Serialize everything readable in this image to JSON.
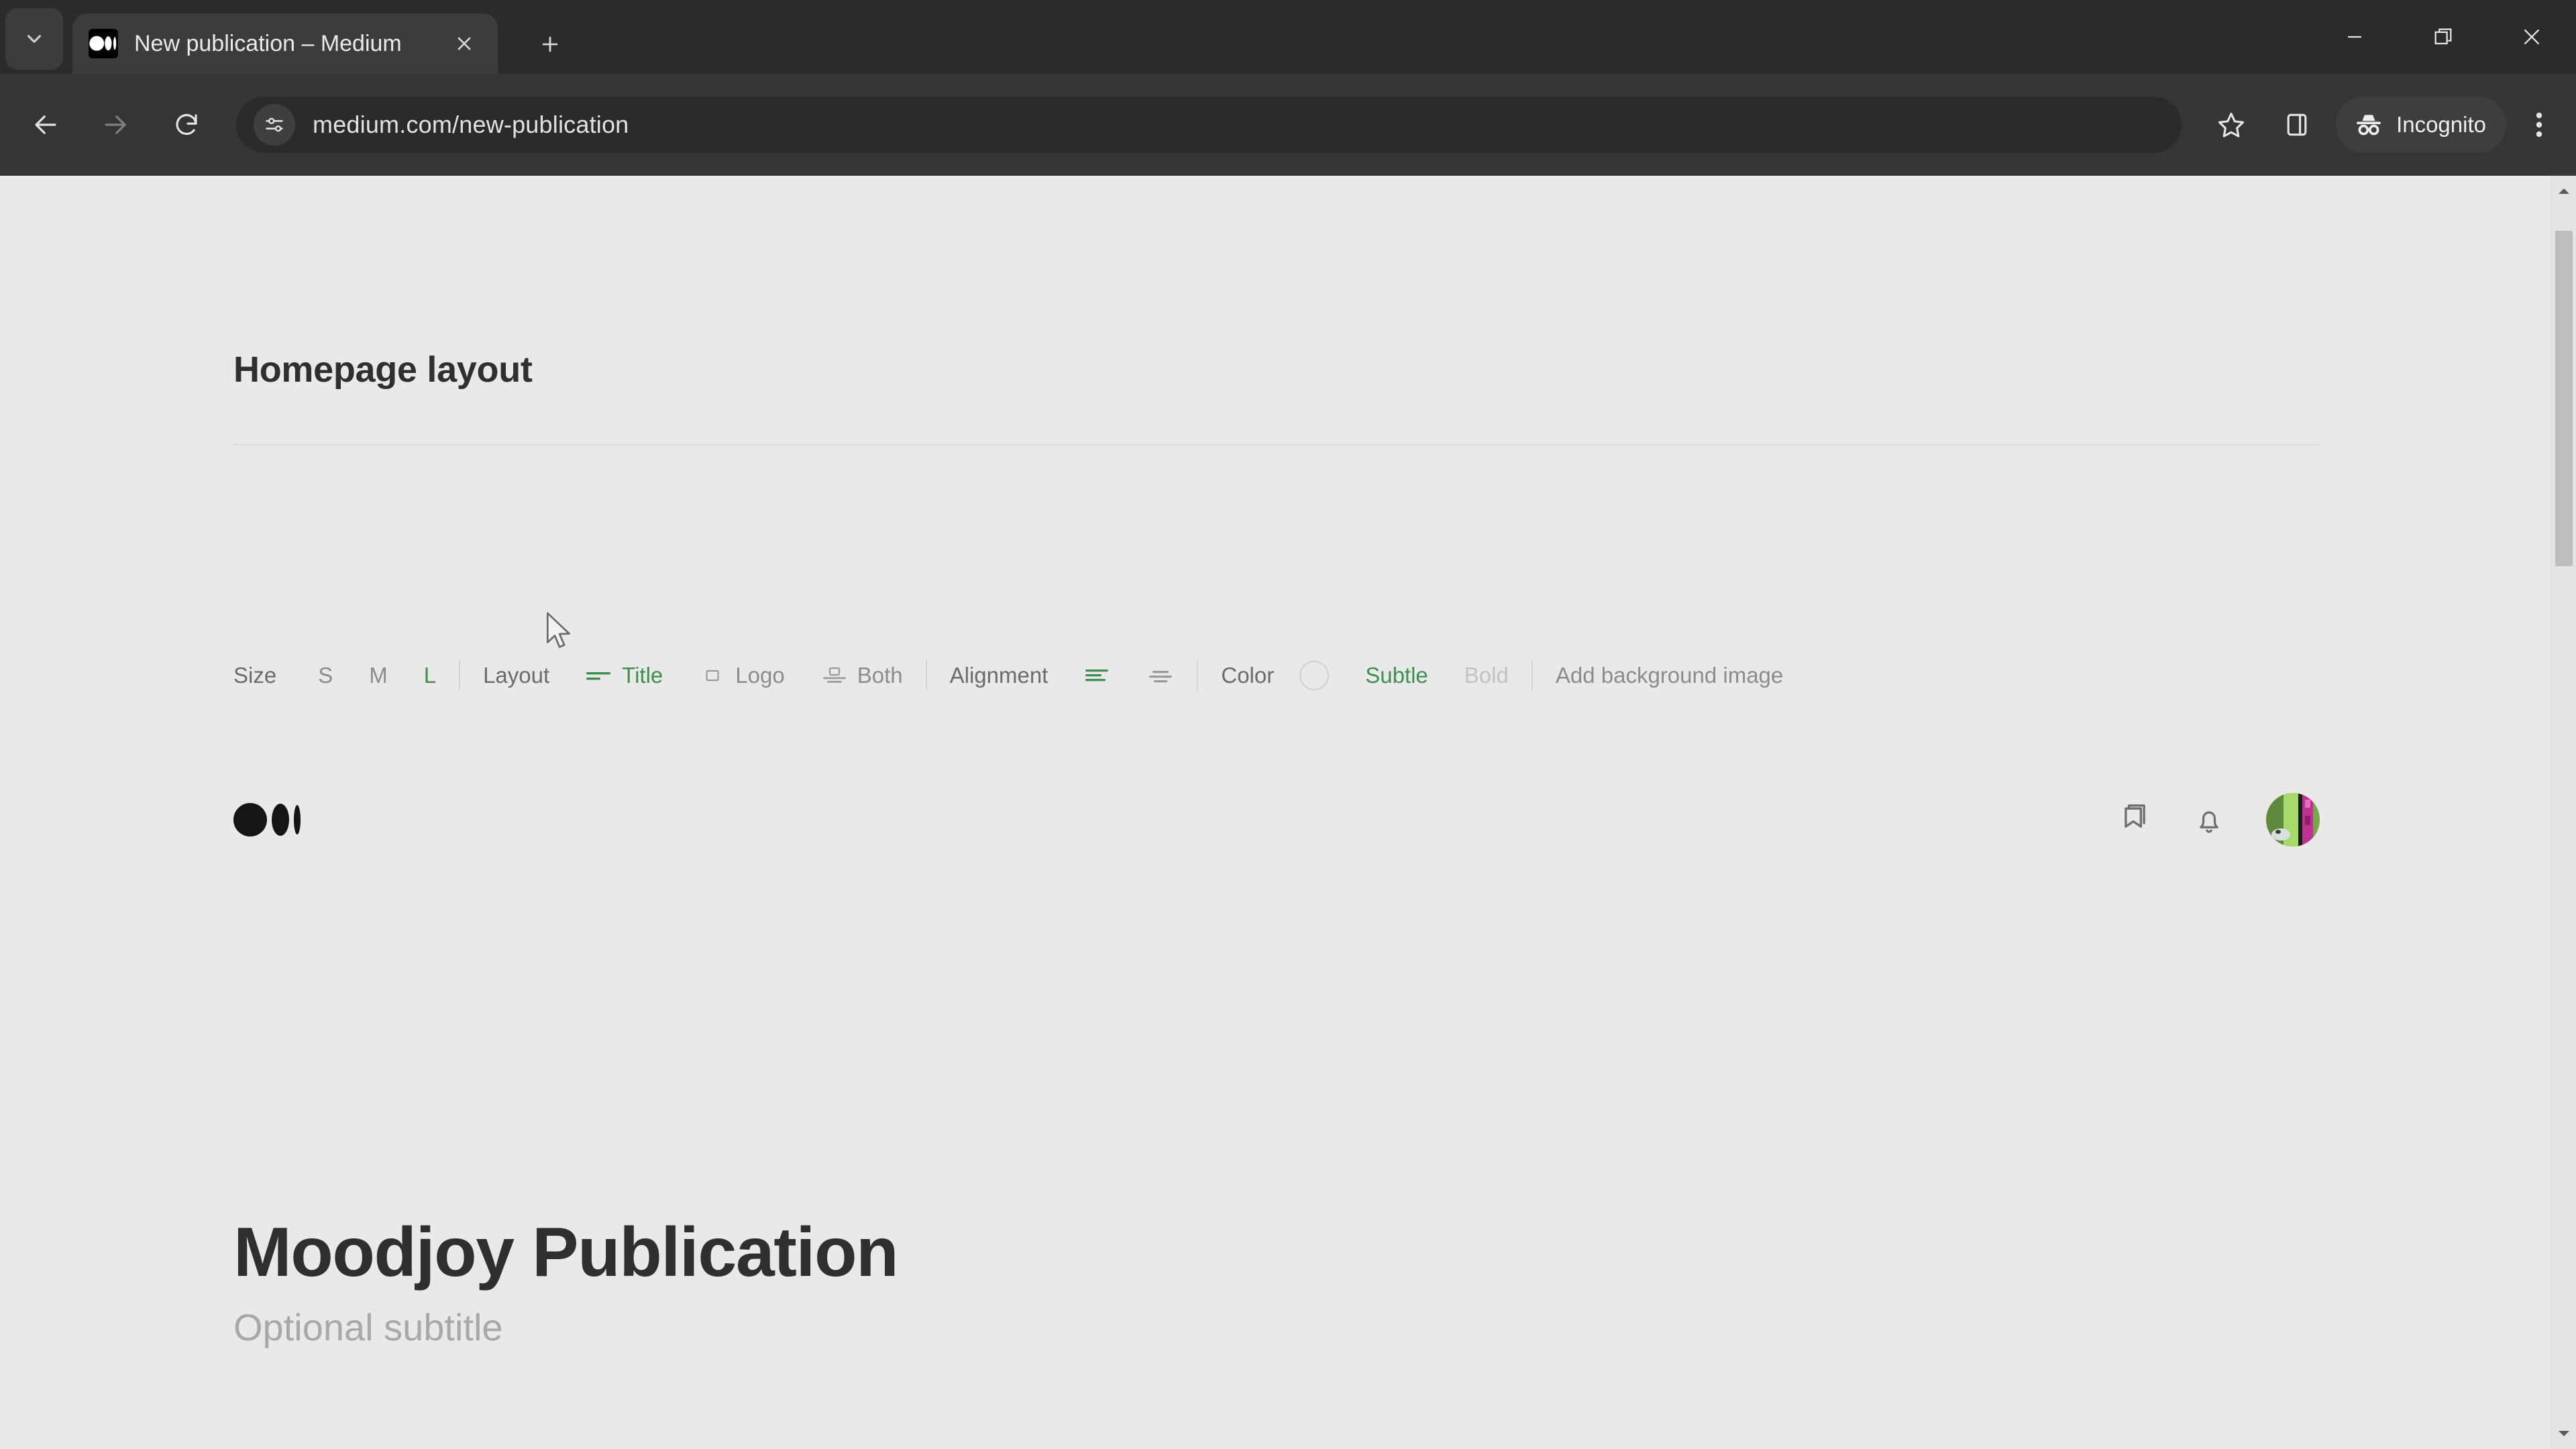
{
  "browser": {
    "tab": {
      "title": "New publication – Medium",
      "favicon": "medium-logo-icon",
      "close_icon": "close-icon"
    },
    "new_tab_icon": "plus-icon",
    "tabstrip_toggle_icon": "chevron-down-icon",
    "window_controls": {
      "minimize": "minimize-icon",
      "maximize": "restore-icon",
      "close": "close-icon"
    },
    "nav": {
      "back_icon": "arrow-left-icon",
      "forward_icon": "arrow-right-icon",
      "reload_icon": "reload-icon"
    },
    "omnibox": {
      "site_info_icon": "site-settings-icon",
      "url": "medium.com/new-publication"
    },
    "actions": {
      "bookmark_icon": "star-icon",
      "side_panel_icon": "side-panel-icon",
      "incognito_label": "Incognito",
      "incognito_icon": "incognito-icon",
      "menu_icon": "three-dots-icon"
    }
  },
  "page": {
    "section_title": "Homepage layout",
    "controls": {
      "size": {
        "label": "Size",
        "options": [
          {
            "label": "S",
            "state": "inactive"
          },
          {
            "label": "M",
            "state": "inactive"
          },
          {
            "label": "L",
            "state": "active"
          }
        ]
      },
      "layout": {
        "label": "Layout",
        "options": [
          {
            "label": "Title",
            "icon": "two-lines-icon",
            "state": "active"
          },
          {
            "label": "Logo",
            "icon": "square-icon",
            "state": "inactive"
          },
          {
            "label": "Both",
            "icon": "logo-over-lines-icon",
            "state": "inactive"
          }
        ]
      },
      "alignment": {
        "label": "Alignment",
        "options": [
          {
            "label": "",
            "icon": "align-left-icon",
            "state": "active"
          },
          {
            "label": "",
            "icon": "align-center-icon",
            "state": "inactive"
          }
        ]
      },
      "color": {
        "label": "Color",
        "swatch": "#e9e9e9",
        "options": [
          {
            "label": "Subtle",
            "state": "active"
          },
          {
            "label": "Bold",
            "state": "disabled"
          }
        ]
      },
      "background": {
        "label": "Add background image"
      }
    },
    "preview": {
      "logo": "medium-logo-icon",
      "header_icons": [
        {
          "icon": "bookmark-icon"
        },
        {
          "icon": "bell-icon"
        },
        {
          "icon": "avatar"
        }
      ],
      "title": "Moodjoy Publication",
      "subtitle": "Optional subtitle"
    }
  },
  "colors": {
    "accent_green": "#3f8f4f",
    "page_bg": "#e9e9e9",
    "chrome_dark": "#353535",
    "titlebar": "#2b2b2b",
    "text_primary": "#2f2f2f",
    "text_muted": "#8c8c8c",
    "text_disabled": "#c2c2c2"
  },
  "scrollbar": {
    "up_icon": "caret-up-icon",
    "down_icon": "caret-down-icon"
  }
}
